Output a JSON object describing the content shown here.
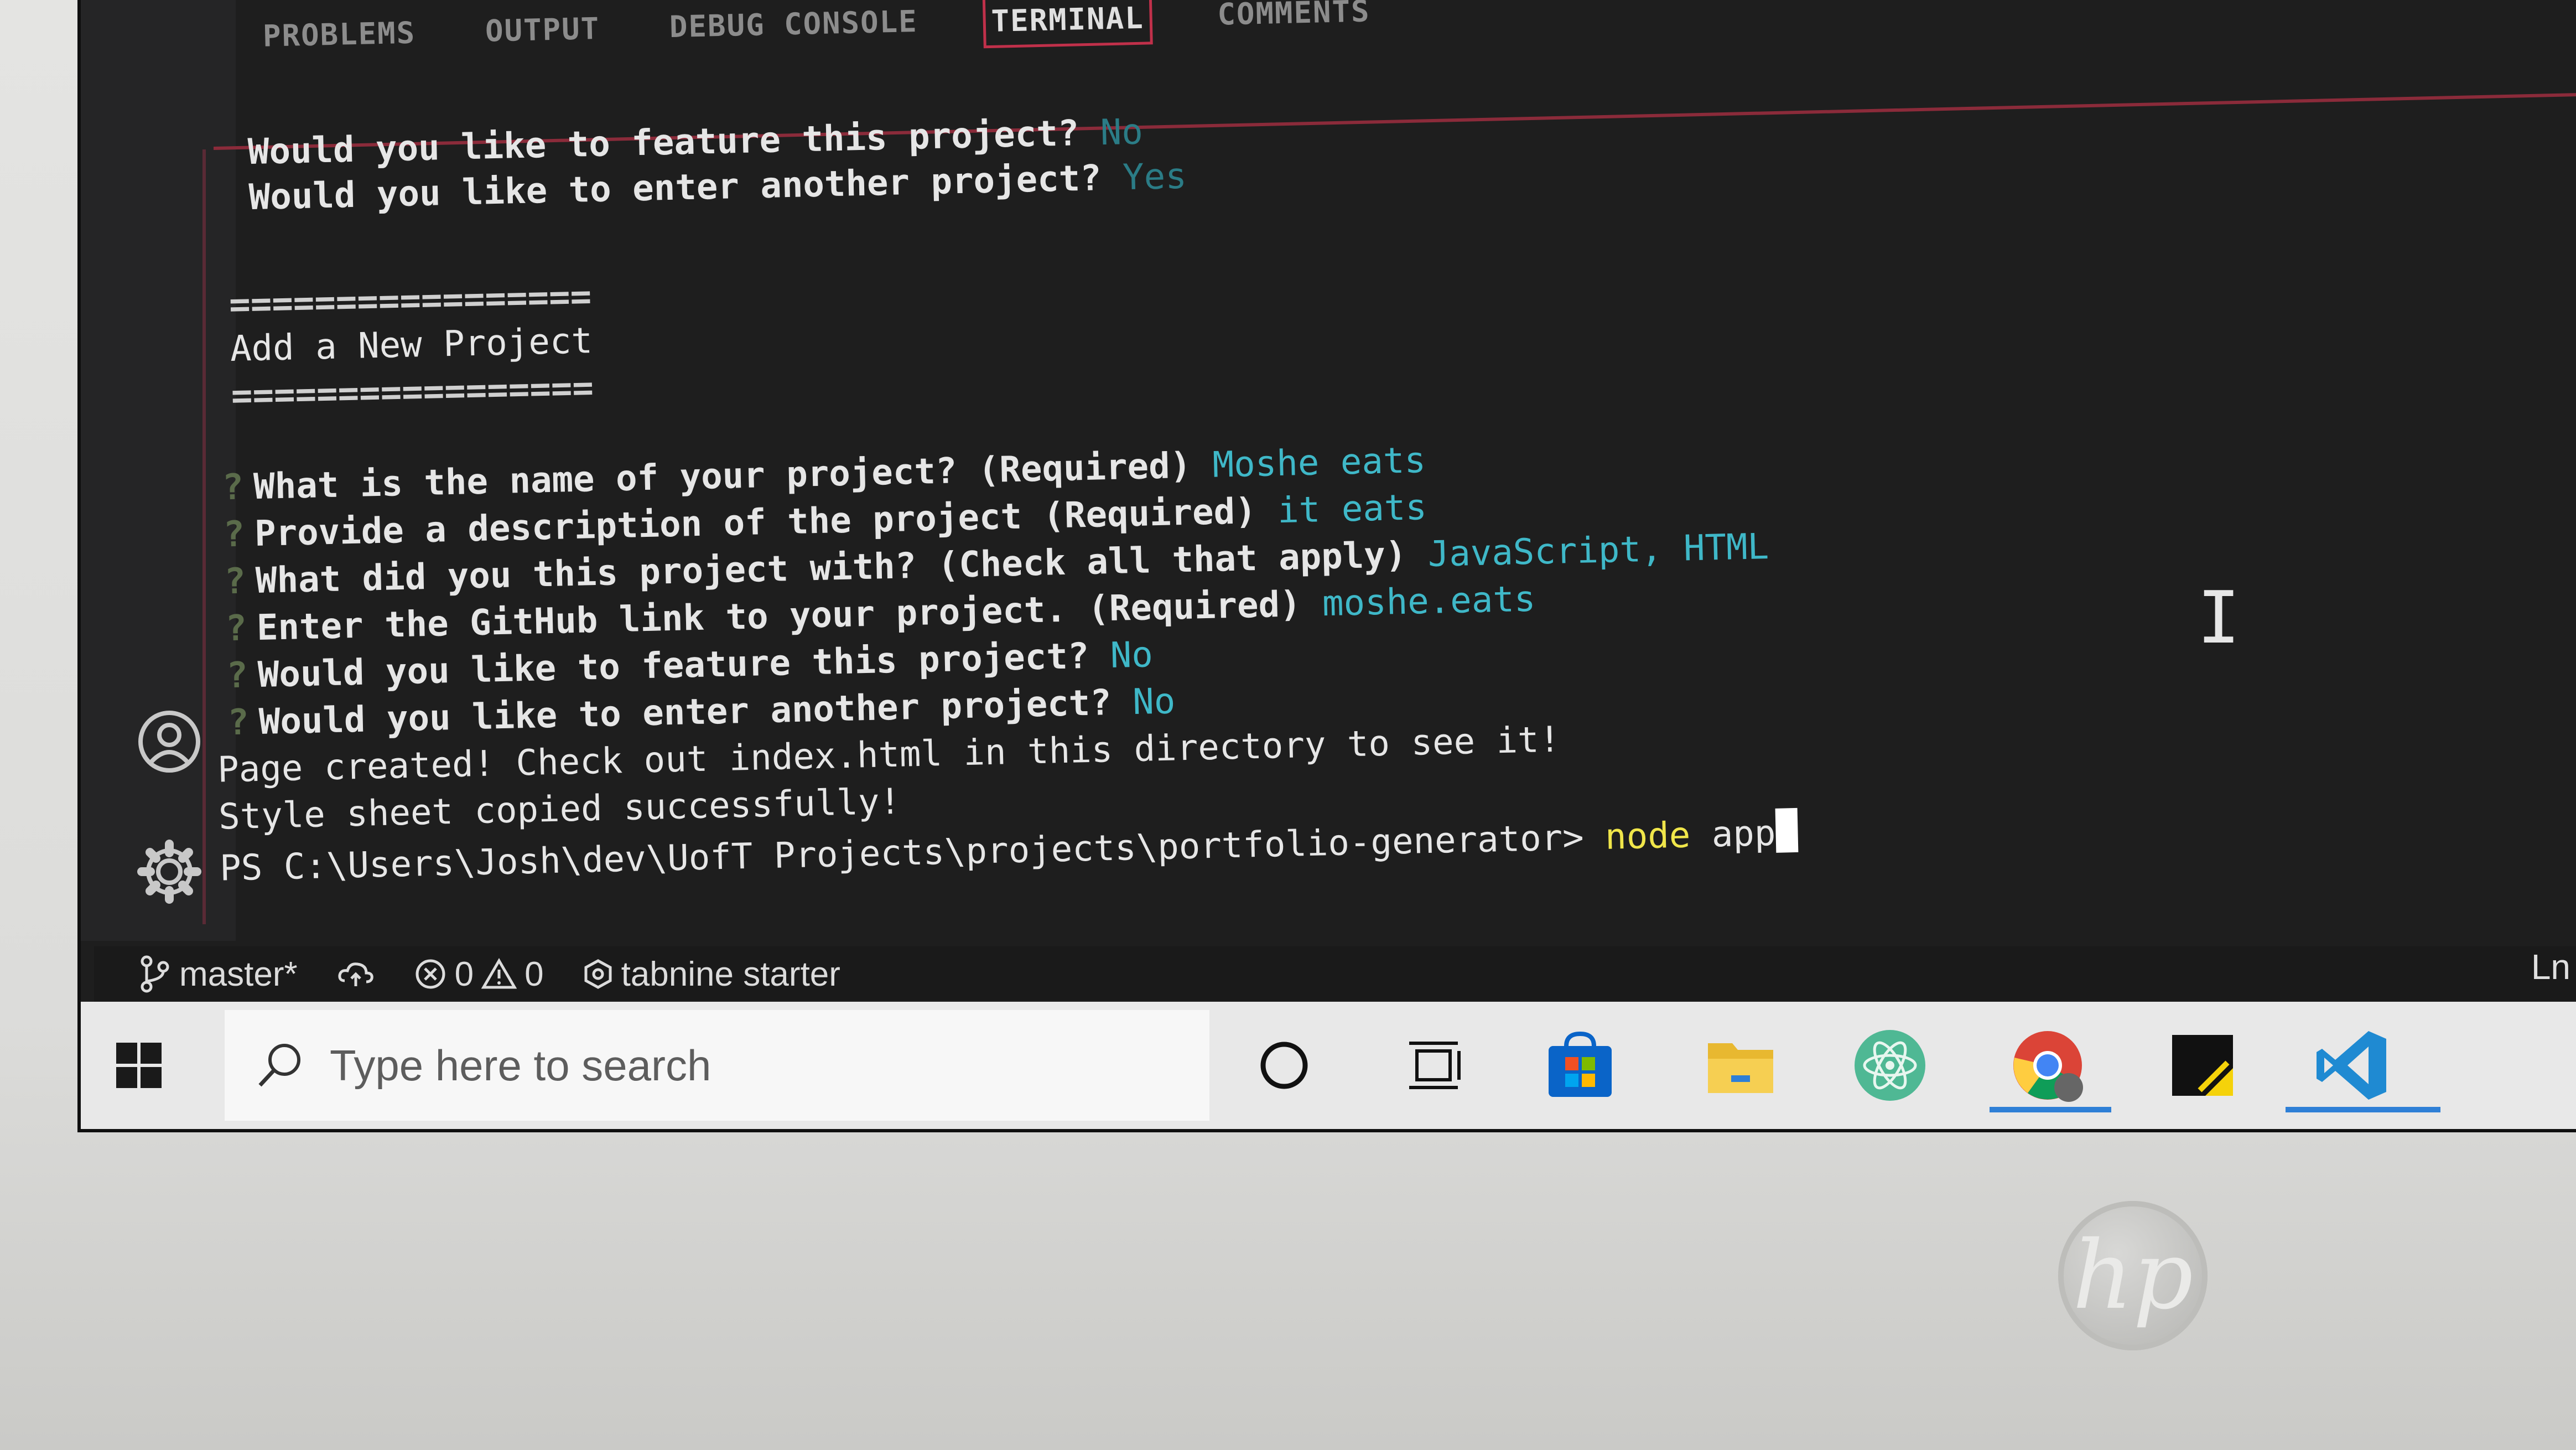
{
  "panel": {
    "tabs": [
      {
        "label": "PROBLEMS",
        "active": false
      },
      {
        "label": "OUTPUT",
        "active": false
      },
      {
        "label": "DEBUG CONSOLE",
        "active": false
      },
      {
        "label": "TERMINAL",
        "active": true
      },
      {
        "label": "COMMENTS",
        "active": false
      }
    ]
  },
  "terminal": {
    "prev_feature_q": "Would you like to feature this project?",
    "prev_feature_a": "No",
    "prev_another_q": "Would you like to enter another project?",
    "prev_another_a": "Yes",
    "separator": "=================",
    "section_title": "Add a New Project",
    "q_name": "What is the name of your project? (Required)",
    "a_name": "Moshe eats",
    "q_desc": "Provide a description of the project (Required)",
    "a_desc": "it eats",
    "q_lang": "What did you this project with? (Check all that apply)",
    "a_lang": "JavaScript, HTML",
    "q_link": "Enter the GitHub link to your project. (Required)",
    "a_link": "moshe.eats",
    "q_feature": "Would you like to feature this project?",
    "a_feature": "No",
    "q_another": "Would you like to enter another project?",
    "a_another": "No",
    "msg_created": "Page created! Check out index.html in this directory to see it!",
    "msg_style": "Style sheet copied successfully!",
    "prompt_path": "PS C:\\Users\\Josh\\dev\\UofT Projects\\projects\\portfolio-generator>",
    "prompt_cmd": "node",
    "prompt_arg": "app",
    "question_mark": "?"
  },
  "status_bar": {
    "branch": "master*",
    "errors": "0",
    "warnings": "0",
    "tabnine": "tabnine starter",
    "ln": "Ln"
  },
  "taskbar": {
    "search_placeholder": "Type here to search",
    "apps": [
      "cortana-icon",
      "task-view-icon",
      "microsoft-store-icon",
      "file-explorer-icon",
      "atom-icon",
      "chrome-icon",
      "sticky-notes-icon",
      "vscode-icon"
    ]
  },
  "colors": {
    "terminal_bg": "#1e1e1e",
    "answer": "#3fb8c8",
    "command": "#f0e64a",
    "tab_active_border": "#c0304a"
  }
}
